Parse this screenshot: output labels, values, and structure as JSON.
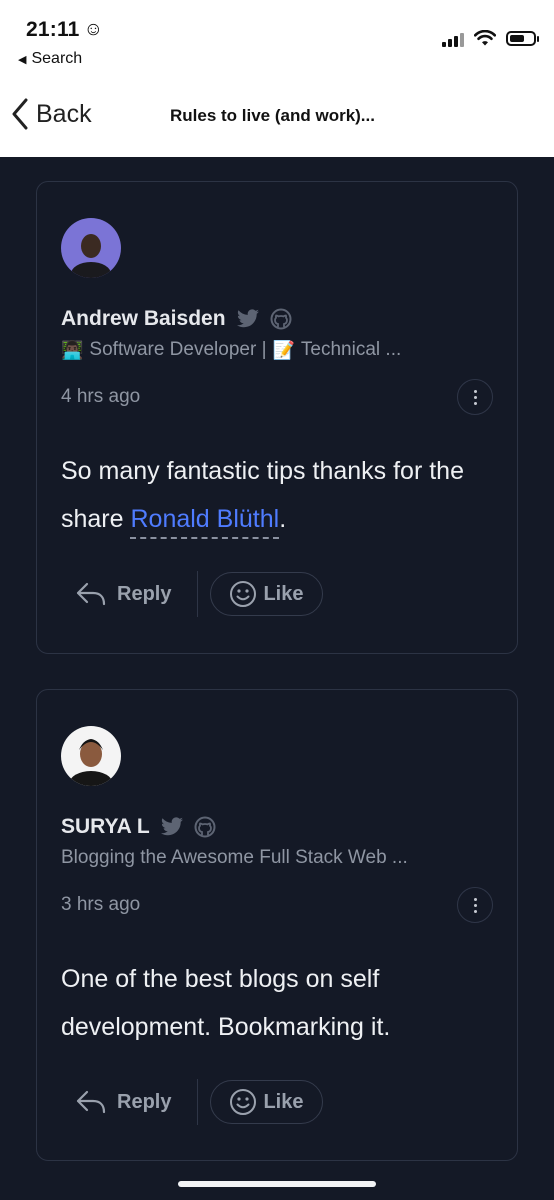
{
  "status_bar": {
    "time": "21:11",
    "back_app_label": "Search"
  },
  "nav": {
    "back_label": "Back",
    "title": "Rules to live (and work)..."
  },
  "comments": [
    {
      "author": "Andrew Baisden",
      "bio_emoji_1": "👨🏿‍💻",
      "bio_text_1": "Software Developer |",
      "bio_emoji_2": "📝",
      "bio_text_2": "Technical ...",
      "time_ago": "4 hrs ago",
      "body_prefix": "So many fantastic tips thanks for the share ",
      "mention": "Ronald Blüthl",
      "body_suffix": ".",
      "reply_label": "Reply",
      "like_label": "Like"
    },
    {
      "author": "SURYA L",
      "bio_text_1": "Blogging the Awesome Full Stack Web ...",
      "time_ago": "3 hrs ago",
      "body": "One of the best blogs on self development. Bookmarking it.",
      "reply_label": "Reply",
      "like_label": "Like"
    }
  ],
  "icons": [
    "smiley-status-icon",
    "signal-icon",
    "wifi-icon",
    "battery-icon",
    "chevron-left-icon",
    "twitter-icon",
    "github-icon",
    "more-icon",
    "reply-icon",
    "like-smiley-icon"
  ],
  "colors": {
    "background": "#141926",
    "mention": "#4f7cff",
    "muted_text": "#8f96a3"
  }
}
